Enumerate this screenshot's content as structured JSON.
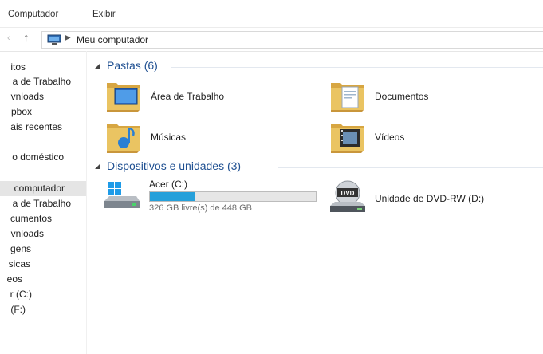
{
  "menu": {
    "items": [
      "Computador",
      "Exibir"
    ]
  },
  "address": {
    "path": "Meu computador"
  },
  "nav": {
    "items": [
      {
        "label": "itos"
      },
      {
        "label": "a de Trabalho"
      },
      {
        "label": "vnloads"
      },
      {
        "label": "pbox"
      },
      {
        "label": "ais recentes"
      },
      {
        "label": "o doméstico"
      },
      {
        "label": "computador",
        "selected": true
      },
      {
        "label": "a de Trabalho"
      },
      {
        "label": "cumentos"
      },
      {
        "label": "vnloads"
      },
      {
        "label": "gens"
      },
      {
        "label": "sicas"
      },
      {
        "label": "eos"
      },
      {
        "label": "r (C:)"
      },
      {
        "label": "(F:)"
      }
    ]
  },
  "groups": {
    "folders": {
      "title": "Pastas (6)",
      "items": [
        {
          "label": "Área de Trabalho",
          "icon": "desktop-folder-icon"
        },
        {
          "label": "Documentos",
          "icon": "documents-folder-icon"
        },
        {
          "label": "Músicas",
          "icon": "music-folder-icon"
        },
        {
          "label": "Vídeos",
          "icon": "videos-folder-icon"
        }
      ]
    },
    "devices": {
      "title": "Dispositivos e unidades (3)",
      "drive_c": {
        "label": "Acer (C:)",
        "free_text": "326 GB livre(s) de 448 GB",
        "used_fraction": 0.27,
        "icon": "hard-drive-icon"
      },
      "dvd": {
        "label": "Unidade de DVD-RW (D:)",
        "icon": "dvd-drive-icon",
        "badge": "DVD"
      }
    }
  },
  "colors": {
    "accent": "#1e4f91",
    "usage_bar": "#26a0da",
    "selection": "#e5e5e5",
    "folder": "#e9c05f"
  }
}
